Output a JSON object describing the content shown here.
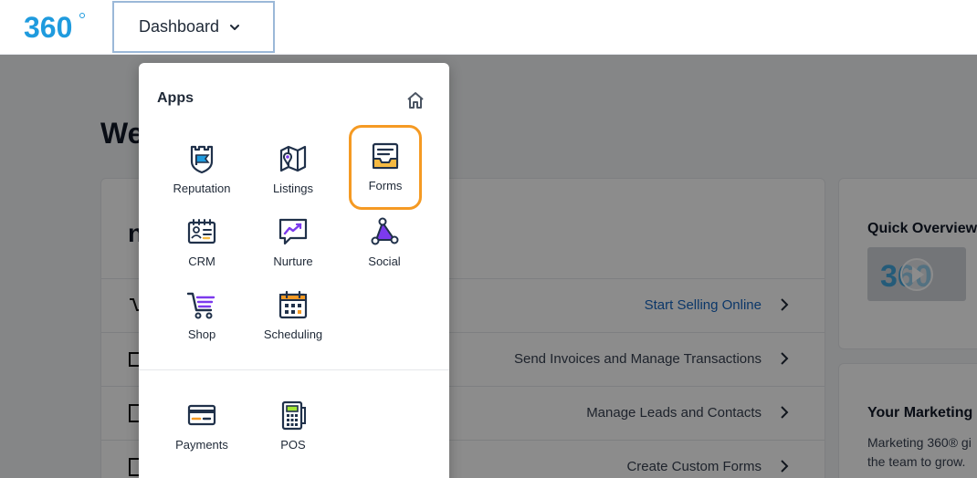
{
  "topbar": {
    "logo_text": "360",
    "dashboard_label": "Dashboard"
  },
  "page": {
    "title": "We",
    "main_card_heading": "n",
    "rows": [
      {
        "label": "Start Selling Online",
        "link": true
      },
      {
        "label": "Send Invoices and Manage Transactions",
        "link": false
      },
      {
        "label": "Manage Leads and Contacts",
        "link": false
      },
      {
        "label": "Create Custom Forms",
        "link": false
      }
    ],
    "quick_overview_title": "Quick Overview",
    "marketing_title": "Your Marketing",
    "marketing_text": "Marketing 360® gi the team to grow."
  },
  "apps_menu": {
    "title": "Apps",
    "apps": [
      {
        "name": "reputation",
        "label": "Reputation",
        "icon": "castle-flag-icon",
        "selected": false
      },
      {
        "name": "listings",
        "label": "Listings",
        "icon": "map-pin-icon",
        "selected": false
      },
      {
        "name": "forms",
        "label": "Forms",
        "icon": "form-tray-icon",
        "selected": true
      },
      {
        "name": "crm",
        "label": "CRM",
        "icon": "contact-card-icon",
        "selected": false
      },
      {
        "name": "nurture",
        "label": "Nurture",
        "icon": "chat-trend-icon",
        "selected": false
      },
      {
        "name": "social",
        "label": "Social",
        "icon": "network-nodes-icon",
        "selected": false
      },
      {
        "name": "shop",
        "label": "Shop",
        "icon": "shopping-cart-icon",
        "selected": false
      },
      {
        "name": "scheduling",
        "label": "Scheduling",
        "icon": "calendar-icon",
        "selected": false
      }
    ],
    "extra_apps": [
      {
        "name": "payments",
        "label": "Payments",
        "icon": "credit-card-icon"
      },
      {
        "name": "pos",
        "label": "POS",
        "icon": "pos-terminal-icon"
      }
    ]
  },
  "colors": {
    "brand_blue": "#1f9bde",
    "brand_navy": "#20314a",
    "highlight_orange": "#f59a23",
    "accent_purple": "#7c3aed",
    "accent_yellow": "#f5b942",
    "link_blue": "#1565c0"
  }
}
